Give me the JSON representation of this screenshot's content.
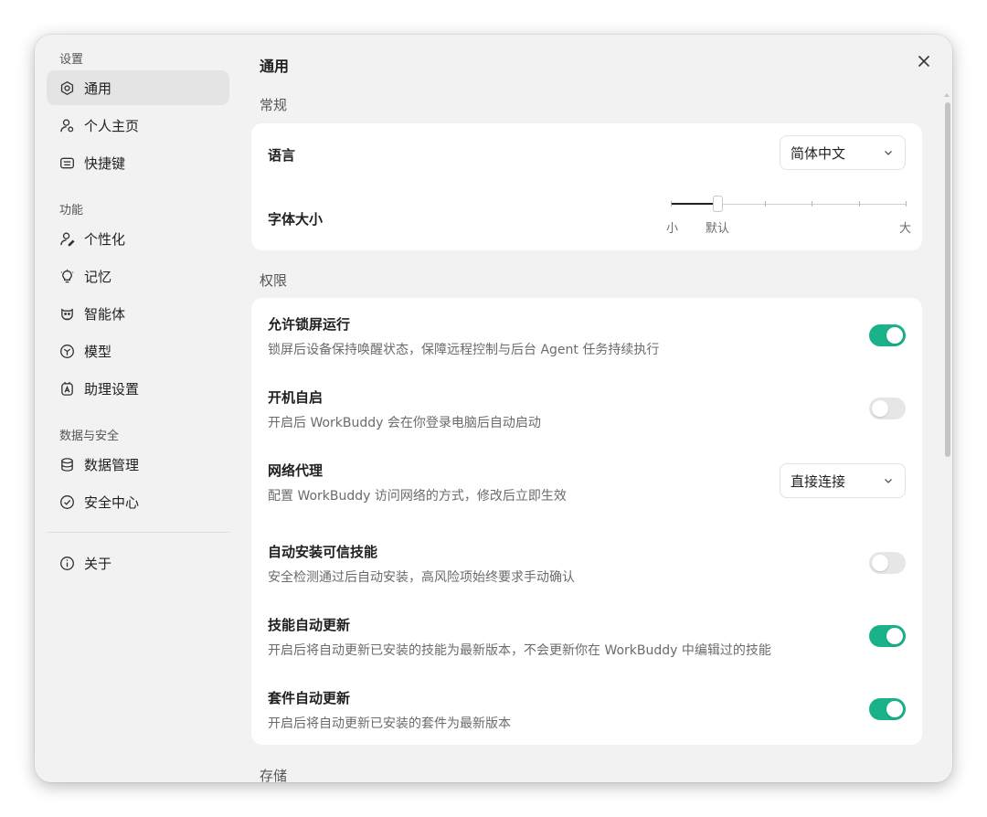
{
  "sidebar": {
    "sections": [
      "设置",
      "功能",
      "数据与安全"
    ],
    "items": [
      {
        "label": "通用",
        "icon": "general-settings-icon",
        "active": true
      },
      {
        "label": "个人主页",
        "icon": "user-profile-icon"
      },
      {
        "label": "快捷键",
        "icon": "keyboard-icon"
      },
      {
        "label": "个性化",
        "icon": "personalize-icon"
      },
      {
        "label": "记忆",
        "icon": "lightbulb-icon"
      },
      {
        "label": "智能体",
        "icon": "agent-icon"
      },
      {
        "label": "模型",
        "icon": "model-cube-icon"
      },
      {
        "label": "助理设置",
        "icon": "assistant-icon"
      },
      {
        "label": "数据管理",
        "icon": "database-icon"
      },
      {
        "label": "安全中心",
        "icon": "shield-check-icon"
      },
      {
        "label": "关于",
        "icon": "info-icon"
      }
    ]
  },
  "main": {
    "title": "通用",
    "sections": {
      "general": "常规",
      "permissions": "权限",
      "storage": "存储"
    },
    "language": {
      "label": "语言",
      "value": "简体中文"
    },
    "font_size": {
      "label": "字体大小",
      "min_label": "小",
      "default_label": "默认",
      "max_label": "大",
      "level_fraction": 0.2
    },
    "permissions": [
      {
        "title": "允许锁屏运行",
        "desc": "锁屏后设备保持唤醒状态，保障远程控制与后台 Agent 任务持续执行",
        "on": true
      },
      {
        "title": "开机自启",
        "desc": "开启后 WorkBuddy 会在你登录电脑后自动启动",
        "on": false
      },
      {
        "title": "网络代理",
        "desc": "配置 WorkBuddy 访问网络的方式，修改后立即生效",
        "select": "直接连接"
      },
      {
        "title": "自动安装可信技能",
        "desc": "安全检测通过后自动安装，高风险项始终要求手动确认",
        "on": false
      },
      {
        "title": "技能自动更新",
        "desc": "开启后将自动更新已安装的技能为最新版本，不会更新你在 WorkBuddy 中编辑过的技能",
        "on": true
      },
      {
        "title": "套件自动更新",
        "desc": "开启后将自动更新已安装的套件为最新版本",
        "on": true
      }
    ]
  },
  "colors": {
    "accent": "#19b289",
    "window_bg": "#f2f2f2",
    "card_bg": "#ffffff",
    "active_item": "#e4e4e4"
  }
}
